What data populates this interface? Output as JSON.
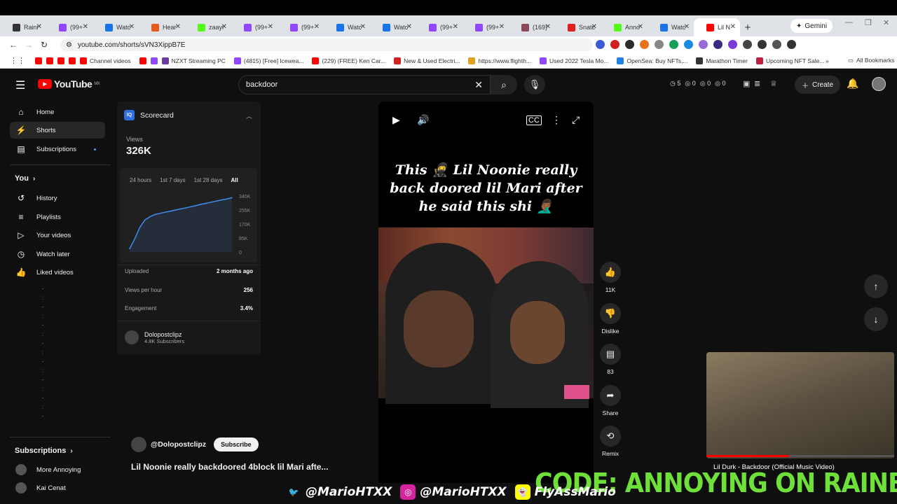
{
  "browser": {
    "tabs": [
      {
        "label": "Raini",
        "color": "#333333"
      },
      {
        "label": "(99+",
        "color": "#9146ff"
      },
      {
        "label": "Watc",
        "color": "#1a73e8"
      },
      {
        "label": "Hear",
        "color": "#e8581a"
      },
      {
        "label": "zaayi",
        "color": "#53fc18"
      },
      {
        "label": "(99+",
        "color": "#9146ff"
      },
      {
        "label": "(99+",
        "color": "#9146ff"
      },
      {
        "label": "Watc",
        "color": "#1a73e8"
      },
      {
        "label": "Watc",
        "color": "#1a73e8"
      },
      {
        "label": "(99+",
        "color": "#9146ff"
      },
      {
        "label": "(99+",
        "color": "#9146ff"
      },
      {
        "label": "(169)",
        "color": "#8a4a5a"
      },
      {
        "label": "Snatc",
        "color": "#e02020"
      },
      {
        "label": "Anno",
        "color": "#53fc18"
      },
      {
        "label": "Watc",
        "color": "#1a73e8"
      },
      {
        "label": "Lil N",
        "color": "#ff0000"
      }
    ],
    "gemini_label": "Gemini",
    "url": "youtube.com/shorts/sVN3XippB7E",
    "bookmarks": [
      {
        "label": "",
        "color": "#ff0000"
      },
      {
        "label": "",
        "color": "#ff0000"
      },
      {
        "label": "",
        "color": "#ff0000"
      },
      {
        "label": "",
        "color": "#ff0000"
      },
      {
        "label": "Channel videos",
        "color": "#ff0000"
      },
      {
        "label": "",
        "color": "#ff0000"
      },
      {
        "label": "",
        "color": "#9146ff"
      },
      {
        "label": "NZXT Streaming PC",
        "color": "#6a3aa0"
      },
      {
        "label": "(4815) [Free] Icewea...",
        "color": "#9146ff"
      },
      {
        "label": "(229) (FREE) Ken Car...",
        "color": "#ff0000"
      },
      {
        "label": "New & Used Electri...",
        "color": "#d02020"
      },
      {
        "label": "https://www.flighth...",
        "color": "#e0a020"
      },
      {
        "label": "Used 2022 Tesla Mo...",
        "color": "#9146ff"
      },
      {
        "label": "OpenSea: Buy NFTs,...",
        "color": "#2081e2"
      },
      {
        "label": "Marathon Timer",
        "color": "#333333"
      },
      {
        "label": "Upcoming NFT Sale...",
        "color": "#c02040"
      }
    ],
    "all_bookmarks": "All Bookmarks"
  },
  "masthead": {
    "logo_text": "YouTube",
    "region": "MX",
    "search_value": "backdoor",
    "stats": [
      "5",
      "0",
      "0",
      "0"
    ],
    "create_label": "Create"
  },
  "sidebar": {
    "items": [
      {
        "label": "Home",
        "icon": "home-icon"
      },
      {
        "label": "Shorts",
        "icon": "shorts-icon"
      },
      {
        "label": "Subscriptions",
        "icon": "subscriptions-icon"
      }
    ],
    "you_header": "You",
    "you_items": [
      {
        "label": "History"
      },
      {
        "label": "Playlists"
      },
      {
        "label": "Your videos"
      },
      {
        "label": "Watch later"
      },
      {
        "label": "Liked videos"
      }
    ],
    "subs_header": "Subscriptions",
    "subs": [
      {
        "label": "More Annoying"
      },
      {
        "label": "Kai Cenat"
      }
    ]
  },
  "scorecard": {
    "title": "Scorecard",
    "views_label": "Views",
    "views_value": "326K",
    "ranges": [
      "24 hours",
      "1st 7 days",
      "1st 28 days",
      "All"
    ],
    "active_range": "All",
    "uploaded_label": "Uploaded",
    "uploaded_value": "2 months ago",
    "vph_label": "Views per hour",
    "vph_value": "256",
    "engagement_label": "Engagement",
    "engagement_value": "3.4%",
    "channel_name": "Dolopostclipz",
    "channel_subs": "4.8K Subscribers"
  },
  "chart_data": {
    "type": "line",
    "y_ticks": [
      "340K",
      "255K",
      "170K",
      "85K",
      "0"
    ],
    "ylim": [
      0,
      340000
    ],
    "x": [
      0,
      1,
      2,
      3,
      4,
      5,
      6,
      7,
      8,
      9,
      10,
      11,
      12,
      13,
      14,
      15,
      16,
      17,
      18,
      19,
      20
    ],
    "values": [
      20000,
      80000,
      150000,
      195000,
      215000,
      228000,
      235000,
      242000,
      248000,
      255000,
      262000,
      268000,
      275000,
      282000,
      290000,
      296000,
      303000,
      310000,
      316000,
      322000,
      330000
    ],
    "color": "#3e8cf0"
  },
  "short": {
    "caption": "This 🥷 Lil Noonie really back doored lil Mari after he said this shi 🤦🏾‍♂️",
    "like_count": "11K",
    "dislike_label": "Dislike",
    "comment_count": "83",
    "share_label": "Share",
    "remix_label": "Remix",
    "channel_handle": "@Dolopostclipz",
    "subscribe_label": "Subscribe",
    "title": "Lil Noonie really backdoored 4block lil Mari afte..."
  },
  "mini_player": {
    "title": "Lil Durk - Backdoor (Official Music Video)",
    "progress": 0.44
  },
  "overlay": {
    "code_banner": "CODE: ANNOYING ON RAINBET",
    "twitter": "@MarioHTXX",
    "instagram": "@MarioHTXX",
    "snapchat": "FlyAssMario"
  }
}
